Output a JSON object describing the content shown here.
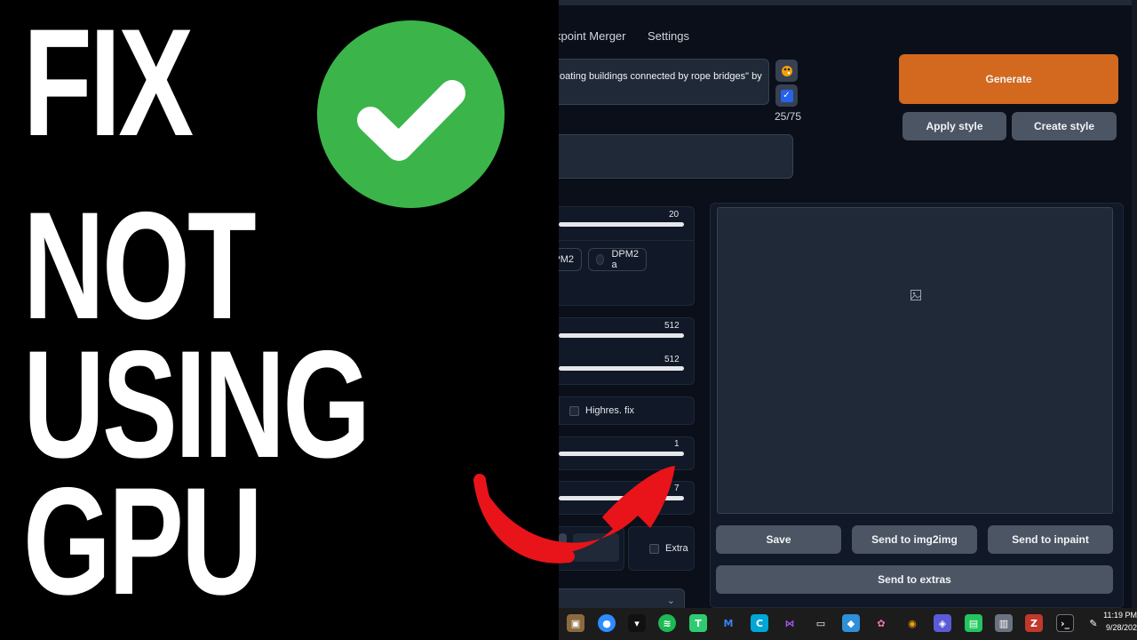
{
  "headline": {
    "line1": "FIX",
    "line2": "NOT",
    "line3": "USING",
    "line4": "GPU"
  },
  "colors": {
    "check_green": "#3bb54a",
    "generate_orange": "#d2691e",
    "arrow_red": "#e8141a"
  },
  "tabs": {
    "checkpoint_merger": "kpoint Merger",
    "settings": "Settings"
  },
  "prompt": {
    "text": "oating buildings connected by rope bridges\" by",
    "token_count": "25/75"
  },
  "buttons": {
    "generate": "Generate",
    "apply_style": "Apply style",
    "create_style": "Create style",
    "save": "Save",
    "send_img2img": "Send to img2img",
    "send_inpaint": "Send to inpaint",
    "send_extras": "Send to extras"
  },
  "params": {
    "steps": "20",
    "sampler_partial": "PM2",
    "sampler_dpm2a": "DPM2 a",
    "width": "512",
    "height": "512",
    "highres_fix": "Highres. fix",
    "batch_count": "1",
    "batch_size_partial": "7",
    "extra": "Extra"
  },
  "clock": {
    "time": "11:19 PM",
    "date": "9/28/202"
  },
  "icons": [
    "paint-palette-icon",
    "checkbox-icon",
    "image-placeholder-icon",
    "chevron-down-icon"
  ]
}
